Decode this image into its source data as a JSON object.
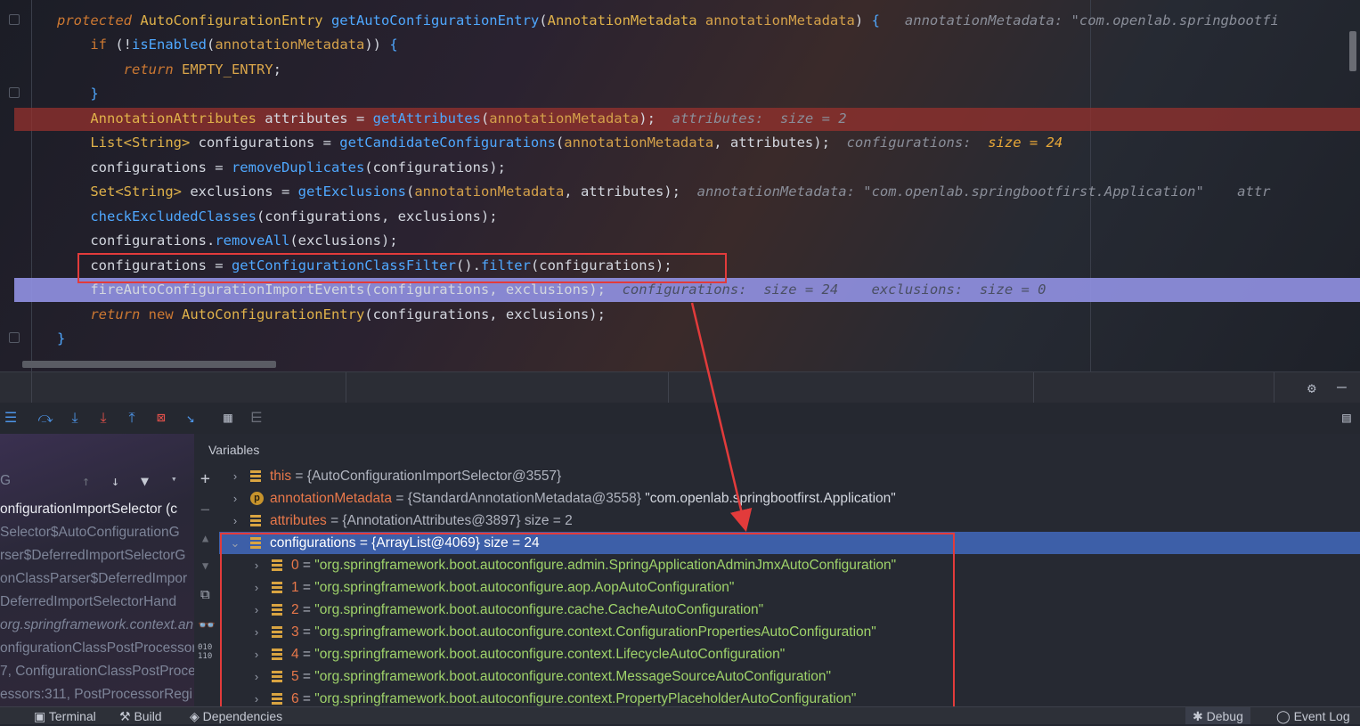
{
  "editor": {
    "lines": [
      {
        "id": "l1",
        "parts": [
          [
            "kwi",
            "protected "
          ],
          [
            "type",
            "AutoConfigurationEntry "
          ],
          [
            "fn",
            "getAutoConfigurationEntry"
          ],
          [
            "plain",
            "("
          ],
          [
            "type",
            "AnnotationMetadata "
          ],
          [
            "param",
            "annotationMetadata"
          ],
          [
            "plain",
            ") "
          ],
          [
            "brace",
            "{"
          ],
          [
            "plain",
            "   "
          ],
          [
            "hint",
            "annotationMetadata: \"com.openlab.springbootfi"
          ]
        ]
      },
      {
        "id": "l2",
        "parts": [
          [
            "plain",
            "    "
          ],
          [
            "kw",
            "if "
          ],
          [
            "plain",
            "(!"
          ],
          [
            "fn",
            "isEnabled"
          ],
          [
            "plain",
            "("
          ],
          [
            "param",
            "annotationMetadata"
          ],
          [
            "plain",
            ")) "
          ],
          [
            "brace",
            "{"
          ]
        ]
      },
      {
        "id": "l3",
        "parts": [
          [
            "plain",
            "        "
          ],
          [
            "kwi",
            "return "
          ],
          [
            "const",
            "EMPTY_ENTRY"
          ],
          [
            "plain",
            ";"
          ]
        ]
      },
      {
        "id": "l4",
        "parts": [
          [
            "plain",
            "    "
          ],
          [
            "brace",
            "}"
          ]
        ]
      },
      {
        "id": "l5",
        "parts": [
          [
            "plain",
            "    "
          ],
          [
            "type",
            "AnnotationAttributes "
          ],
          [
            "plain",
            "attributes = "
          ],
          [
            "fn",
            "getAttributes"
          ],
          [
            "plain",
            "("
          ],
          [
            "param",
            "annotationMetadata"
          ],
          [
            "plain",
            ");  "
          ],
          [
            "hint",
            "attributes:  size = 2"
          ]
        ]
      },
      {
        "id": "l6",
        "parts": [
          [
            "plain",
            "    "
          ],
          [
            "type",
            "List<String> "
          ],
          [
            "plain",
            "configurations = "
          ],
          [
            "fn",
            "getCandidateConfigurations"
          ],
          [
            "plain",
            "("
          ],
          [
            "param",
            "annotationMetadata"
          ],
          [
            "plain",
            ", attributes);  "
          ],
          [
            "hint",
            "configurations:  "
          ],
          [
            "hint-size",
            "size = 24"
          ]
        ]
      },
      {
        "id": "l7",
        "parts": [
          [
            "plain",
            "    configurations = "
          ],
          [
            "fn",
            "removeDuplicates"
          ],
          [
            "plain",
            "(configurations);"
          ]
        ]
      },
      {
        "id": "l8",
        "parts": [
          [
            "plain",
            "    "
          ],
          [
            "type",
            "Set<String> "
          ],
          [
            "plain",
            "exclusions = "
          ],
          [
            "fn",
            "getExclusions"
          ],
          [
            "plain",
            "("
          ],
          [
            "param",
            "annotationMetadata"
          ],
          [
            "plain",
            ", attributes);  "
          ],
          [
            "hint",
            "annotationMetadata: \"com.openlab.springbootfirst.Application\"    attr"
          ]
        ]
      },
      {
        "id": "l9",
        "parts": [
          [
            "plain",
            "    "
          ],
          [
            "fn",
            "checkExcludedClasses"
          ],
          [
            "plain",
            "(configurations, exclusions);"
          ]
        ]
      },
      {
        "id": "l10",
        "parts": [
          [
            "plain",
            "    configurations."
          ],
          [
            "fn",
            "removeAll"
          ],
          [
            "plain",
            "(exclusions);"
          ]
        ]
      },
      {
        "id": "l11",
        "parts": [
          [
            "plain",
            "    configurations = "
          ],
          [
            "fn",
            "getConfigurationClassFilter"
          ],
          [
            "plain",
            "()."
          ],
          [
            "fn",
            "filter"
          ],
          [
            "plain",
            "(configurations);"
          ]
        ]
      },
      {
        "id": "l12",
        "parts": [
          [
            "plain",
            "    fireAutoConfigurationImportEvents(configurations, exclusions);  "
          ],
          [
            "hint-exec",
            "configurations:  size = 24    exclusions:  size = 0"
          ]
        ]
      },
      {
        "id": "l13",
        "parts": [
          [
            "plain",
            "    "
          ],
          [
            "kwi",
            "return "
          ],
          [
            "kw",
            "new "
          ],
          [
            "type",
            "AutoConfigurationEntry"
          ],
          [
            "plain",
            "(configurations, exclusions);"
          ]
        ]
      },
      {
        "id": "l14",
        "parts": [
          [
            "brace",
            "}"
          ]
        ]
      }
    ]
  },
  "toolbar": {
    "icons": [
      "list-icon",
      "step-over-icon",
      "step-into-icon",
      "force-step-into-icon",
      "step-out-icon",
      "drop-frame-icon",
      "run-to-cursor-icon",
      "evaluate-icon",
      "trace-icon"
    ]
  },
  "frames": {
    "items": [
      {
        "text": "G",
        "style": ""
      },
      {
        "text": "onfigurationImportSelector (c",
        "style": "sel"
      },
      {
        "text": "Selector$AutoConfigurationG",
        "style": ""
      },
      {
        "text": "rser$DeferredImportSelectorG",
        "style": ""
      },
      {
        "text": "onClassParser$DeferredImpor",
        "style": ""
      },
      {
        "text": "DeferredImportSelectorHand",
        "style": ""
      },
      {
        "text": "org.springframework.context.an",
        "style": "it"
      },
      {
        "text": "onfigurationClassPostProcessor",
        "style": ""
      },
      {
        "text": "7, ConfigurationClassPostProce",
        "style": ""
      },
      {
        "text": "essors:311, PostProcessorRegi",
        "style": ""
      }
    ]
  },
  "variables": {
    "header": "Variables",
    "rows": [
      {
        "expanded": false,
        "icon": "field",
        "name": "this",
        "value": " = {AutoConfigurationImportSelector@3557}",
        "extra": "",
        "indent": 0
      },
      {
        "expanded": false,
        "icon": "param",
        "name": "annotationMetadata",
        "value": " = {StandardAnnotationMetadata@3558} ",
        "extra": "\"com.openlab.springbootfirst.Application\"",
        "indent": 0
      },
      {
        "expanded": false,
        "icon": "field",
        "name": "attributes",
        "value": " = {AnnotationAttributes@3897}  size = 2",
        "extra": "",
        "indent": 0
      },
      {
        "expanded": true,
        "icon": "field",
        "name": "configurations",
        "value": " = {ArrayList@4069}  size = 24",
        "extra": "",
        "indent": 0,
        "selected": true
      },
      {
        "expanded": false,
        "icon": "field",
        "name": "0",
        "value": " = ",
        "extra": "\"org.springframework.boot.autoconfigure.admin.SpringApplicationAdminJmxAutoConfiguration\"",
        "indent": 1
      },
      {
        "expanded": false,
        "icon": "field",
        "name": "1",
        "value": " = ",
        "extra": "\"org.springframework.boot.autoconfigure.aop.AopAutoConfiguration\"",
        "indent": 1
      },
      {
        "expanded": false,
        "icon": "field",
        "name": "2",
        "value": " = ",
        "extra": "\"org.springframework.boot.autoconfigure.cache.CacheAutoConfiguration\"",
        "indent": 1
      },
      {
        "expanded": false,
        "icon": "field",
        "name": "3",
        "value": " = ",
        "extra": "\"org.springframework.boot.autoconfigure.context.ConfigurationPropertiesAutoConfiguration\"",
        "indent": 1
      },
      {
        "expanded": false,
        "icon": "field",
        "name": "4",
        "value": " = ",
        "extra": "\"org.springframework.boot.autoconfigure.context.LifecycleAutoConfiguration\"",
        "indent": 1
      },
      {
        "expanded": false,
        "icon": "field",
        "name": "5",
        "value": " = ",
        "extra": "\"org.springframework.boot.autoconfigure.context.MessageSourceAutoConfiguration\"",
        "indent": 1
      },
      {
        "expanded": false,
        "icon": "field",
        "name": "6",
        "value": " = ",
        "extra": "\"org.springframework.boot.autoconfigure.context.PropertyPlaceholderAutoConfiguration\"",
        "indent": 1
      }
    ]
  },
  "statusbar": {
    "terminal": "Terminal",
    "build": "Build",
    "dependencies": "Dependencies",
    "debug": "Debug",
    "event_log": "Event Log"
  },
  "colors": {
    "annotation_red": "#e23b3b",
    "selected_row": "#3d5fa8",
    "exec_line": "#8f8fe0",
    "breakpoint_line": "#96322d"
  }
}
